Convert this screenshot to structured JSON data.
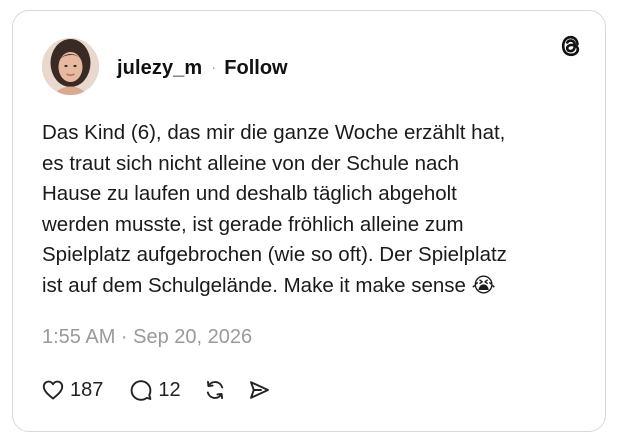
{
  "post": {
    "author": {
      "username": "julezy_m",
      "separator": "·",
      "follow_label": "Follow"
    },
    "text": "Das Kind (6), das mir die ganze Woche erzählt hat,\nes traut sich nicht alleine von der Schule nach\nHause zu laufen und deshalb täglich abgeholt\nwerden musste, ist gerade fröhlich alleine zum\nSpielplatz aufgebrochen (wie so oft). Der Spielplatz\nist auf dem Schulgelände. Make it make sense 😭",
    "timestamp": "1:55 AM · Sep 20, 2026",
    "actions": {
      "likes": "187",
      "replies": "12"
    }
  },
  "icons": {
    "logo": "threads-logo-icon",
    "like": "heart-icon",
    "reply": "speech-bubble-icon",
    "repost": "repost-icon",
    "share": "send-icon"
  },
  "colors": {
    "text": "#1a1a1a",
    "muted": "#9a9a9a",
    "border": "#d9d9d9"
  }
}
